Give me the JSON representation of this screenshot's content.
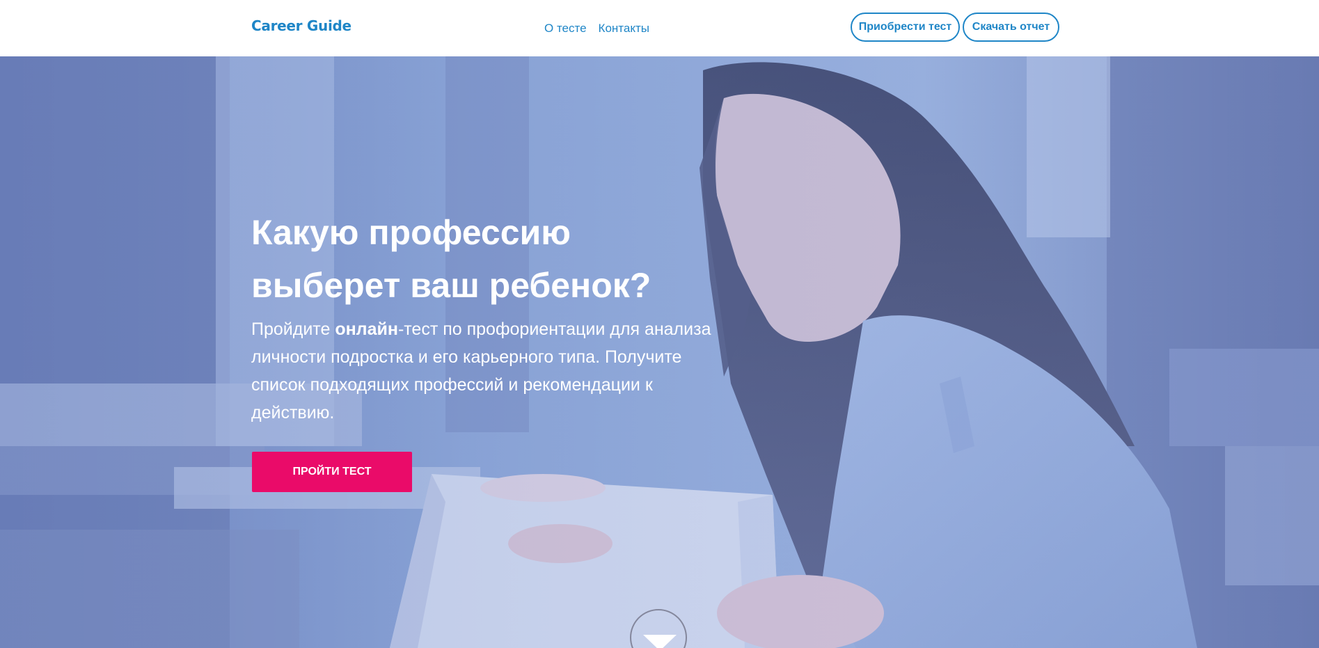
{
  "header": {
    "logo": "Career Guide",
    "nav": [
      {
        "label": "О тесте"
      },
      {
        "label": "Контакты"
      }
    ],
    "buy_button": "Приобрести тест",
    "report_button": "Скачать отчет"
  },
  "hero": {
    "title_line1": "Какую профессию",
    "title_line2": "выберет ваш ребенок?",
    "desc_pre": "Пройдите ",
    "desc_bold": "онлайн",
    "desc_post": "-тест по профориентации для анализа личности подростка и его карьерного типа. Получите список подходящих профессий и рекомендации к действию.",
    "cta_button": "ПРОЙТИ ТЕСТ",
    "scroll_icon": "chevron-down-icon"
  },
  "colors": {
    "brand_blue": "#1f86c7",
    "cta_pink": "#ea0b69",
    "hero_overlay": "#8fa5d3"
  }
}
